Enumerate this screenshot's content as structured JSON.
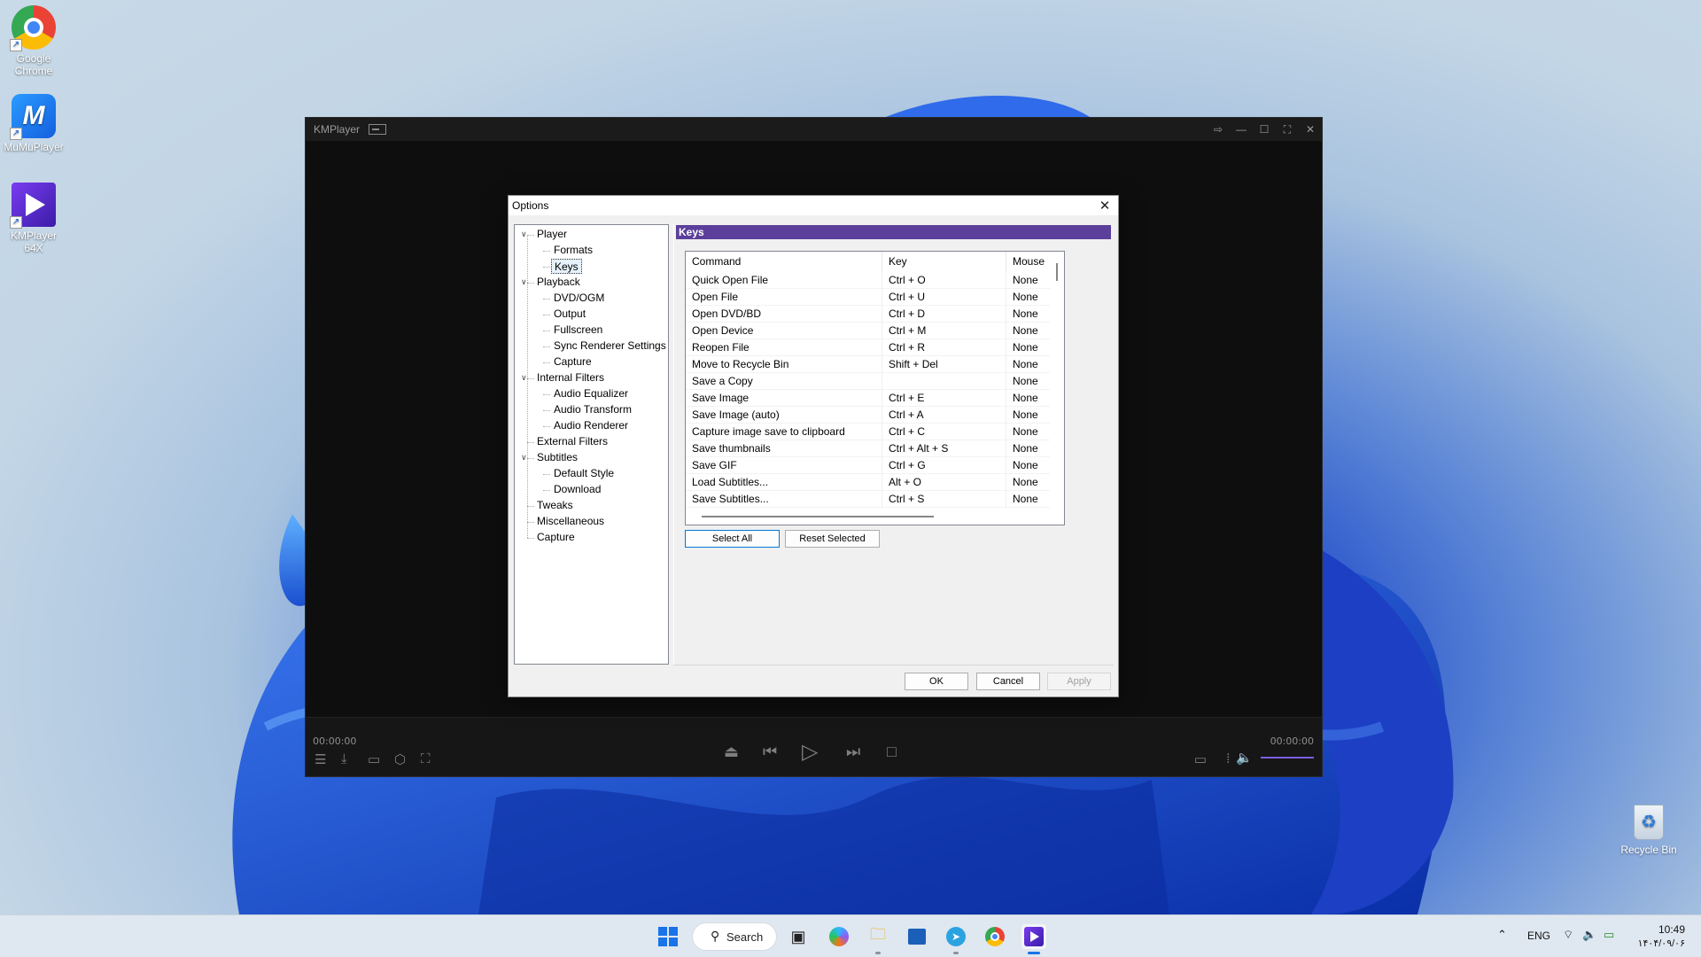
{
  "desktop": {
    "icons": [
      {
        "label": "Google Chrome"
      },
      {
        "label": "MuMuPlayer"
      },
      {
        "label": "KMPlayer 64X"
      }
    ],
    "recycle_bin": "Recycle Bin"
  },
  "kmplayer": {
    "title": "KMPlayer",
    "time_current": "00:00:00",
    "time_total": "00:00:00"
  },
  "options": {
    "title": "Options",
    "tree": [
      {
        "label": "Player",
        "level": 0,
        "expanded": true
      },
      {
        "label": "Formats",
        "level": 1
      },
      {
        "label": "Keys",
        "level": 1,
        "selected": true
      },
      {
        "label": "Playback",
        "level": 0,
        "expanded": true
      },
      {
        "label": "DVD/OGM",
        "level": 1
      },
      {
        "label": "Output",
        "level": 1
      },
      {
        "label": "Fullscreen",
        "level": 1
      },
      {
        "label": "Sync Renderer Settings",
        "level": 1
      },
      {
        "label": "Capture",
        "level": 1
      },
      {
        "label": "Internal Filters",
        "level": 0,
        "expanded": true
      },
      {
        "label": "Audio Equalizer",
        "level": 1
      },
      {
        "label": "Audio Transform",
        "level": 1
      },
      {
        "label": "Audio Renderer",
        "level": 1
      },
      {
        "label": "External Filters",
        "level": 0
      },
      {
        "label": "Subtitles",
        "level": 0,
        "expanded": true
      },
      {
        "label": "Default Style",
        "level": 1
      },
      {
        "label": "Download",
        "level": 1
      },
      {
        "label": "Tweaks",
        "level": 0
      },
      {
        "label": "Miscellaneous",
        "level": 0
      },
      {
        "label": "Capture",
        "level": 0
      }
    ],
    "panel_title": "Keys",
    "columns": [
      "Command",
      "Key",
      "Mouse"
    ],
    "rows": [
      [
        "Quick Open File",
        "Ctrl + O",
        "None"
      ],
      [
        "Open File",
        "Ctrl + U",
        "None"
      ],
      [
        "Open DVD/BD",
        "Ctrl + D",
        "None"
      ],
      [
        "Open Device",
        "Ctrl + M",
        "None"
      ],
      [
        "Reopen File",
        "Ctrl + R",
        "None"
      ],
      [
        "Move to Recycle Bin",
        "Shift + Del",
        "None"
      ],
      [
        "Save a Copy",
        "",
        "None"
      ],
      [
        "Save Image",
        "Ctrl + E",
        "None"
      ],
      [
        "Save Image (auto)",
        "Ctrl + A",
        "None"
      ],
      [
        "Capture image save to clipboard",
        "Ctrl + C",
        "None"
      ],
      [
        "Save thumbnails",
        "Ctrl + Alt + S",
        "None"
      ],
      [
        "Save GIF",
        "Ctrl + G",
        "None"
      ],
      [
        "Load Subtitles...",
        "Alt + O",
        "None"
      ],
      [
        "Save Subtitles...",
        "Ctrl + S",
        "None"
      ]
    ],
    "select_all": "Select All",
    "reset_selected": "Reset Selected",
    "ok": "OK",
    "cancel": "Cancel",
    "apply": "Apply"
  },
  "taskbar": {
    "search_label": "Search",
    "language": "ENG",
    "time": "10:49",
    "date": "۱۴۰۴/۰۹/۰۶"
  },
  "colors": {
    "accent": "#5b3f9b",
    "volume": "#7b5fe5"
  }
}
